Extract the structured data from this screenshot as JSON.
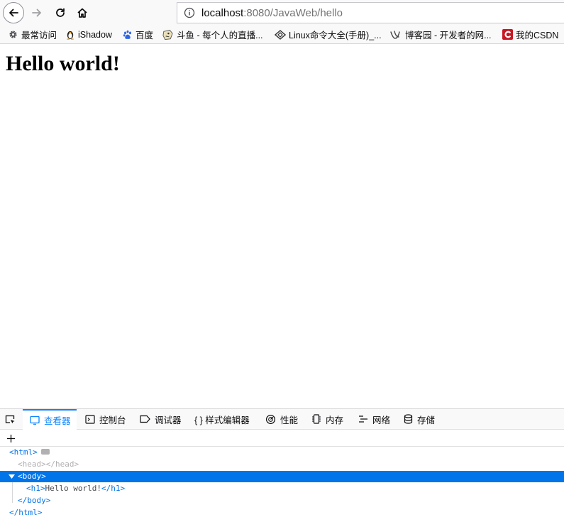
{
  "browser": {
    "url_host": "localhost",
    "url_rest": ":8080/JavaWeb/hello"
  },
  "bookmarks": [
    {
      "label": "最常访问",
      "icon": "gear-icon"
    },
    {
      "label": "iShadow",
      "icon": "penguin-icon"
    },
    {
      "label": "百度",
      "icon": "baidu-paw-icon"
    },
    {
      "label": "斗鱼 - 每个人的直播...",
      "icon": "douyu-icon"
    },
    {
      "label": "Linux命令大全(手册)_...",
      "icon": "linux-diamond-icon"
    },
    {
      "label": "博客园 - 开发者的网...",
      "icon": "cnblogs-icon"
    },
    {
      "label": "我的CSDN",
      "icon": "csdn-icon"
    }
  ],
  "page": {
    "heading": "Hello world!"
  },
  "devtools": {
    "tabs": [
      {
        "label": "查看器",
        "icon": "inspector-icon",
        "active": true
      },
      {
        "label": "控制台",
        "icon": "console-icon"
      },
      {
        "label": "调试器",
        "icon": "debugger-icon"
      },
      {
        "label": "{ } 样式编辑器",
        "icon": "style-editor-icon"
      },
      {
        "label": "性能",
        "icon": "performance-icon"
      },
      {
        "label": "内存",
        "icon": "memory-icon"
      },
      {
        "label": "网络",
        "icon": "network-icon"
      },
      {
        "label": "存储",
        "icon": "storage-icon"
      }
    ],
    "markup": {
      "html_open": "<html>",
      "head": "<head></head>",
      "body_open": "<body>",
      "h1_open": "<h1>",
      "h1_text": "Hello world!",
      "h1_close": "</h1>",
      "body_close": "</body>",
      "html_close": "</html>"
    },
    "colors": {
      "accent": "#0a84ff",
      "selection": "#0074e8"
    }
  }
}
